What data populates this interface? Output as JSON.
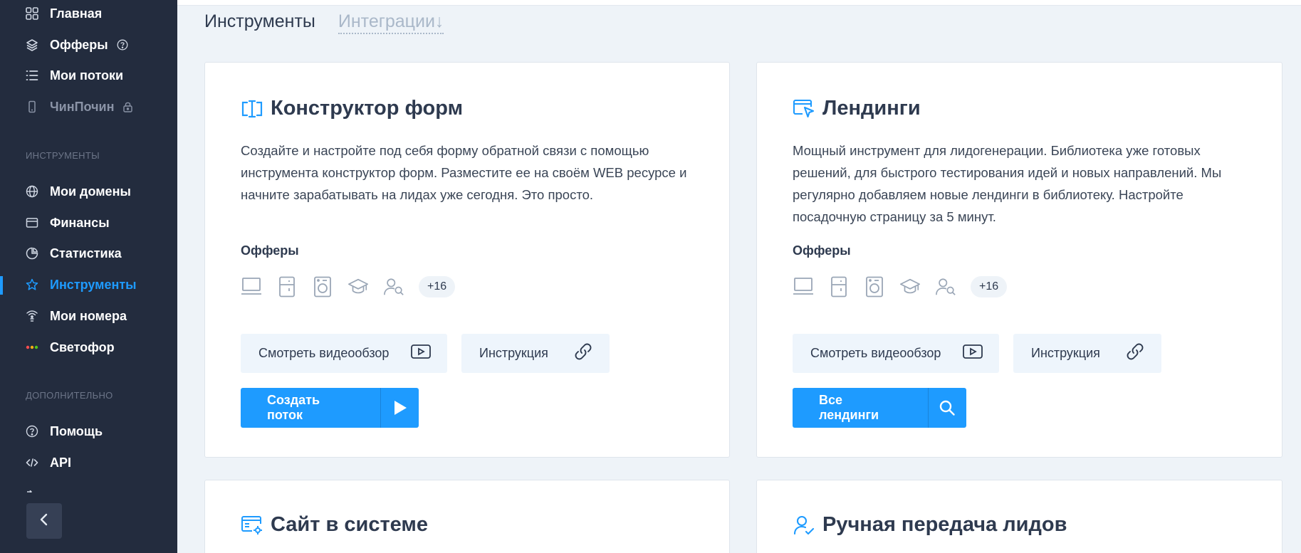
{
  "sidebar": {
    "items_top": [
      {
        "label": "Главная",
        "icon": "grid-icon"
      },
      {
        "label": "Офферы",
        "icon": "layers-icon",
        "tail_icon": "help-icon"
      },
      {
        "label": "Мои потоки",
        "icon": "list-icon"
      },
      {
        "label": "ЧинПочин",
        "icon": "phone-icon",
        "tail_icon": "lock-icon"
      }
    ],
    "section_tools": "ИНСТРУМЕНТЫ",
    "items_tools": [
      {
        "label": "Мои домены",
        "icon": "globe-icon"
      },
      {
        "label": "Финансы",
        "icon": "wallet-icon"
      },
      {
        "label": "Статистика",
        "icon": "pie-chart-icon"
      },
      {
        "label": "Инструменты",
        "icon": "star-icon"
      },
      {
        "label": "Мои номера",
        "icon": "router-icon"
      },
      {
        "label": "Светофор",
        "icon": "traffic-light-icon"
      }
    ],
    "section_extra": "ДОПОЛНИТЕЛЬНО",
    "items_extra": [
      {
        "label": "Помощь",
        "icon": "help-icon"
      },
      {
        "label": "API",
        "icon": "code-icon"
      }
    ],
    "collapse_icon": "chevron-left-icon"
  },
  "tabs": {
    "tools": "Инструменты",
    "integrations": "Интеграции",
    "integrations_arrow": "↓"
  },
  "cards": {
    "forms": {
      "title": "Конструктор форм",
      "description": "Создайте и настройте под себя форму обратной связи с помощью инструмента конструктор форм. Разместите ее на своём WEB ресурсе и начните зарабатывать на лидах уже сегодня. Это просто.",
      "offers_label": "Офферы",
      "offers_more": "+16",
      "video_label": "Смотреть видеообзор",
      "instruction_label": "Инструкция",
      "primary_label": "Создать поток",
      "primary_icon": "play-icon"
    },
    "landings": {
      "title": "Лендинги",
      "description": "Мощный инструмент для лидогенерации. Библиотека уже готовых решений, для быстрого тестирования идей и новых направлений. Мы регулярно добавляем новые лендинги в библиотеку. Настройте посадочную страницу за 5 минут.",
      "offers_label": "Офферы",
      "offers_more": "+16",
      "video_label": "Смотреть видеообзор",
      "instruction_label": "Инструкция",
      "primary_label": "Все лендинги",
      "primary_icon": "search-icon"
    },
    "site": {
      "title": "Сайт в системе"
    },
    "manual": {
      "title": "Ручная передача лидов"
    }
  },
  "colors": {
    "accent": "#1e9bff",
    "sidebar_bg": "#232c3e",
    "page_bg": "#eef3f8"
  }
}
